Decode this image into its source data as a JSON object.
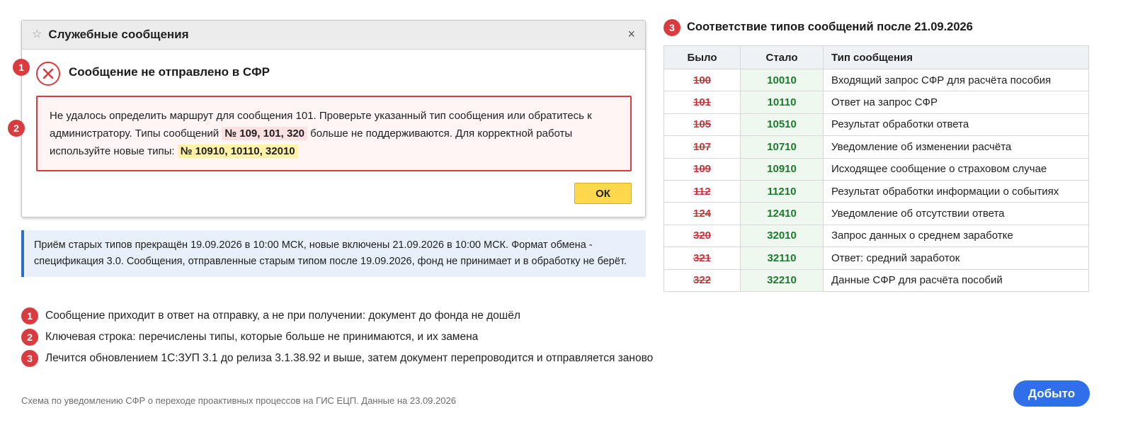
{
  "dialog": {
    "title": "Служебные сообщения",
    "close_label": "×",
    "star_label": "☆",
    "error_heading": "Сообщение не отправлено в СФР",
    "message_part1": "Не удалось определить маршрут для сообщения 101. Проверьте указанный тип сообщения или обратитесь к администратору. Типы сообщений",
    "old_types": "№ 109, 101, 320",
    "message_part2": "больше не поддерживаются. Для корректной работы используйте новые типы:",
    "new_types": "№ 10910, 10110, 32010",
    "ok_label": "ОК"
  },
  "badges": {
    "one": "1",
    "two": "2",
    "three": "3"
  },
  "info_note": "Приём старых типов прекращён 19.09.2026 в 10:00 МСК, новые включены 21.09.2026 в 10:00 МСК. Формат обмена - спецификация 3.0. Сообщения, отправленные старым типом после 19.09.2026, фонд не принимает и в обработку не берёт.",
  "legend": [
    {
      "num": "1",
      "text": "Сообщение приходит в ответ на отправку, а не при получении: документ до фонда не дошёл"
    },
    {
      "num": "2",
      "text": "Ключевая строка: перечислены типы, которые больше не принимаются, и их замена"
    },
    {
      "num": "3",
      "text": "Лечится обновлением 1С:ЗУП 3.1 до релиза 3.1.38.92 и выше, затем документ перепроводится и отправляется заново"
    }
  ],
  "footnote": "Схема по уведомлению СФР о переходе проактивных процессов на ГИС ЕЦП. Данные на 23.09.2026",
  "done_label": "Добыто",
  "table": {
    "title": "Соответствие типов сообщений после 21.09.2026",
    "headers": [
      "Было",
      "Стало",
      "Тип сообщения"
    ],
    "rows": [
      {
        "old": "100",
        "new": "10010",
        "desc": "Входящий запрос СФР для расчёта пособия"
      },
      {
        "old": "101",
        "new": "10110",
        "desc": "Ответ на запрос СФР"
      },
      {
        "old": "105",
        "new": "10510",
        "desc": "Результат обработки ответа"
      },
      {
        "old": "107",
        "new": "10710",
        "desc": "Уведомление об изменении расчёта"
      },
      {
        "old": "109",
        "new": "10910",
        "desc": "Исходящее сообщение о страховом случае"
      },
      {
        "old": "112",
        "new": "11210",
        "desc": "Результат обработки информации о событиях"
      },
      {
        "old": "124",
        "new": "12410",
        "desc": "Уведомление об отсутствии ответа"
      },
      {
        "old": "320",
        "new": "32010",
        "desc": "Запрос данных о среднем заработке"
      },
      {
        "old": "321",
        "new": "32110",
        "desc": "Ответ: средний заработок"
      },
      {
        "old": "322",
        "new": "32210",
        "desc": "Данные СФР для расчёта пособий"
      }
    ]
  },
  "colors": {
    "badge": "#d93b3f",
    "error_border": "#d93b3f",
    "ok_button": "#ffd84d",
    "info_accent": "#2f6fbf",
    "done_button": "#2f6fea",
    "old_type_text": "#c0363a",
    "new_type_text": "#1c7a2f"
  }
}
